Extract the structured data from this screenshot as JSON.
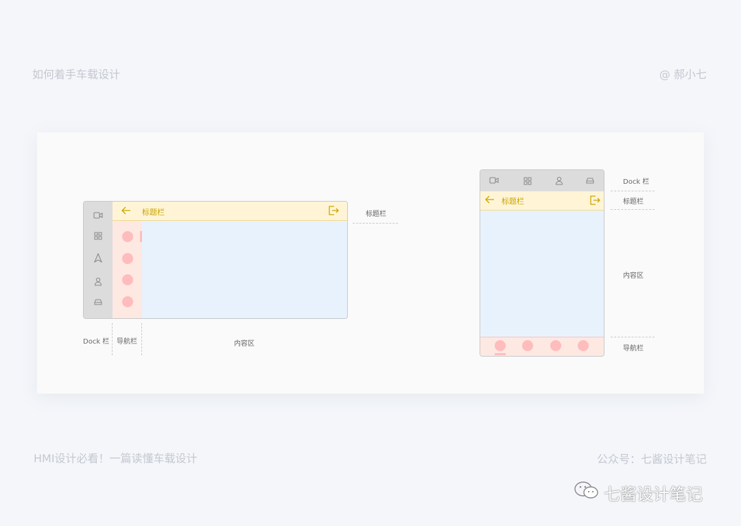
{
  "header": {
    "left": "如何着手车载设计",
    "right": "@ 郝小七"
  },
  "landscape": {
    "title": "标题栏",
    "labels": {
      "title_bar": "标题栏",
      "dock": "Dock 栏",
      "nav": "导航栏",
      "content": "内容区"
    },
    "dock_icons": [
      "video-icon",
      "apps-icon",
      "nav-arrow-icon",
      "user-icon",
      "car-icon"
    ],
    "nav_dots": 4
  },
  "portrait": {
    "title": "标题栏",
    "labels": {
      "dock": "Dock 栏",
      "title_bar": "标题栏",
      "content": "内容区",
      "nav": "导航栏"
    },
    "dock_icons": [
      "video-icon",
      "apps-icon",
      "user-icon",
      "car-icon"
    ],
    "nav_dots": 4
  },
  "footer": {
    "left": "HMI设计必看！一篇读懂车载设计",
    "right": "公众号：七酱设计笔记"
  },
  "watermark": "七酱设计笔记",
  "colors": {
    "dock": "#dcdcdc",
    "title_bar": "#fff5d6",
    "title_text": "#c9a400",
    "nav": "#fde8e2",
    "nav_dot": "#ffbcbc",
    "content": "#e8f2fd"
  }
}
